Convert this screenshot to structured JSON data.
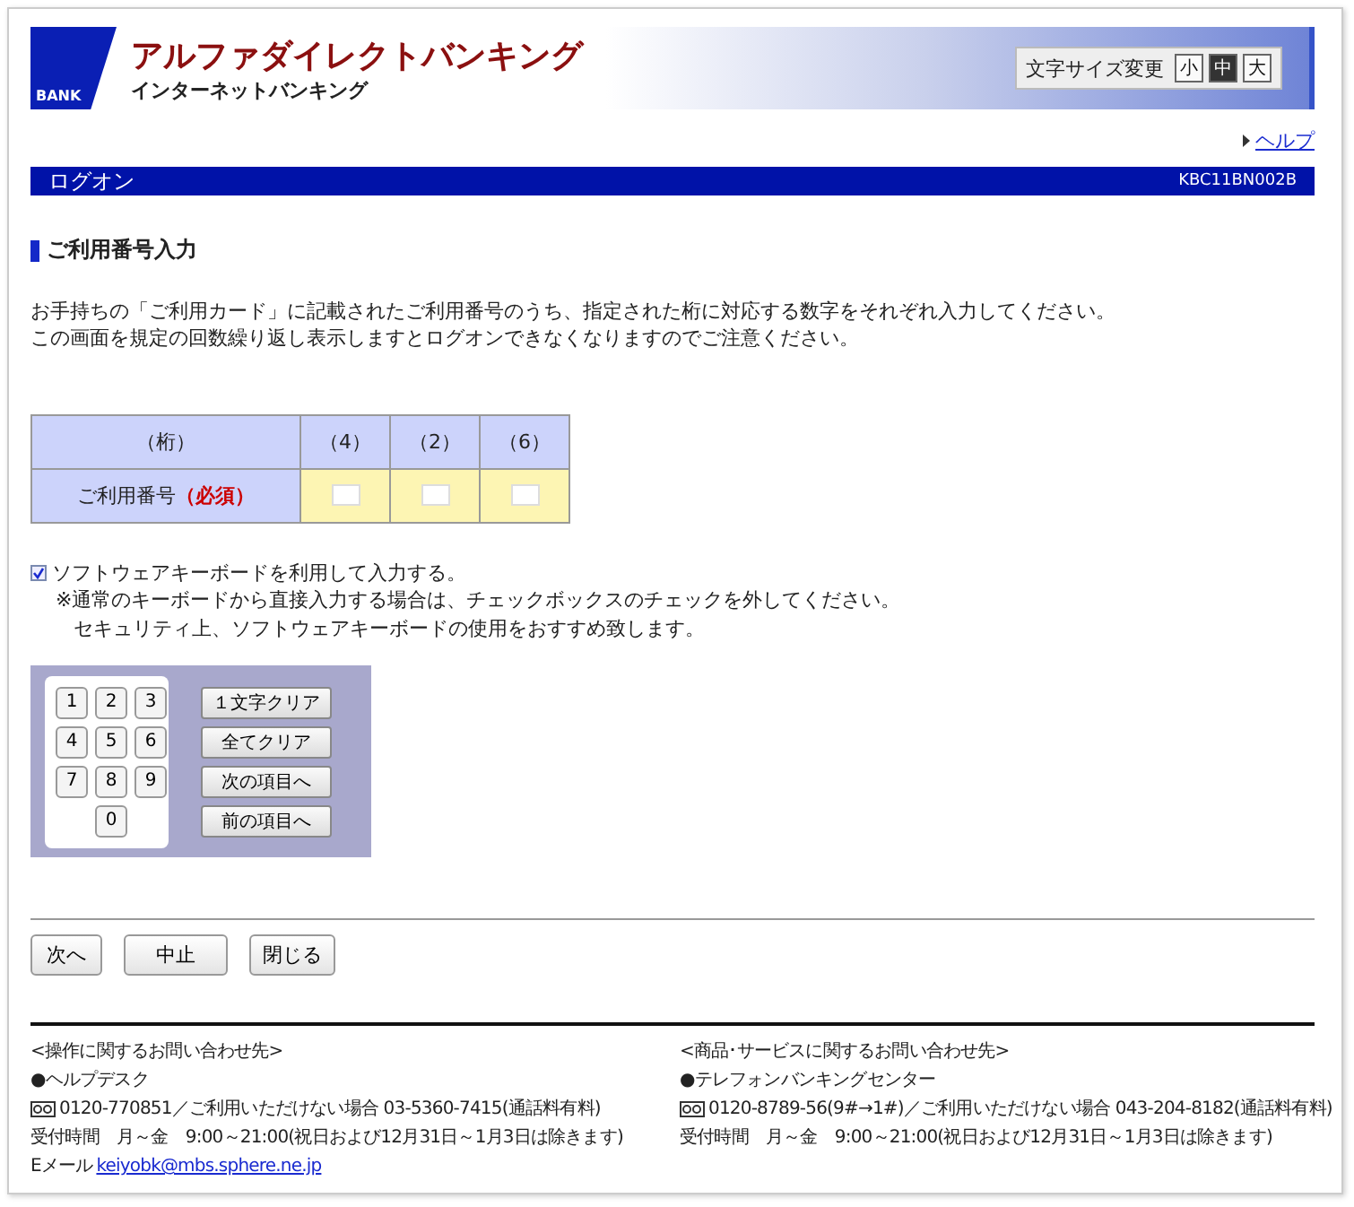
{
  "header": {
    "title": "アルファダイレクトバンキング",
    "subtitle": "インターネットバンキング",
    "logo_text": "BANK",
    "font_size": {
      "label": "文字サイズ変更",
      "options": [
        {
          "label": "小",
          "selected": false
        },
        {
          "label": "中",
          "selected": true
        },
        {
          "label": "大",
          "selected": false
        }
      ]
    }
  },
  "help_link": "ヘルプ",
  "page_bar": {
    "title": "ログオン",
    "code": "KBC11BN002B"
  },
  "section_title": "ご利用番号入力",
  "instructions": [
    "お手持ちの「ご利用カード」に記載されたご利用番号のうち、指定された桁に対応する数字をそれぞれ入力してください。",
    "この画面を規定の回数繰り返し表示しますとログオンできなくなりますのでご注意ください。"
  ],
  "digit_table": {
    "header_label": "（桁）",
    "row_label": "ご利用番号",
    "required": "（必須）",
    "columns": [
      {
        "label": "（4）"
      },
      {
        "label": "（2）"
      },
      {
        "label": "（6）"
      }
    ]
  },
  "software_keyboard": {
    "label": "ソフトウェアキーボードを利用して入力する。",
    "checked": true,
    "notes": [
      "※通常のキーボードから直接入力する場合は、チェックボックスのチェックを外してください。",
      "セキュリティ上、ソフトウェアキーボードの使用をおすすめ致します。"
    ]
  },
  "keypad": {
    "keys": [
      "1",
      "2",
      "3",
      "4",
      "5",
      "6",
      "7",
      "8",
      "9",
      "0"
    ],
    "actions": [
      "１文字クリア",
      "全てクリア",
      "次の項目へ",
      "前の項目へ"
    ]
  },
  "buttons": [
    "次へ",
    "中止",
    "閉じる"
  ],
  "contacts": [
    {
      "heading": "<操作に関するお問い合わせ先>",
      "name": "●ヘルプデスク",
      "phone": "0120-770851／ご利用いただけない場合 03-5360-7415(通話料有料)",
      "hours": "受付時間　月～金　9:00～21:00(祝日および12月31日～1月3日は除きます)",
      "email_label": "Eメール",
      "email": "keiyobk@mbs.sphere.ne.jp"
    },
    {
      "heading": "<商品･サービスに関するお問い合わせ先>",
      "name": "●テレフォンバンキングセンター",
      "phone": "0120-8789-56(9#→1#)／ご利用いただけない場合 043-204-8182(通話料有料)",
      "hours": "受付時間　月～金　9:00～21:00(祝日および12月31日～1月3日は除きます)"
    }
  ]
}
